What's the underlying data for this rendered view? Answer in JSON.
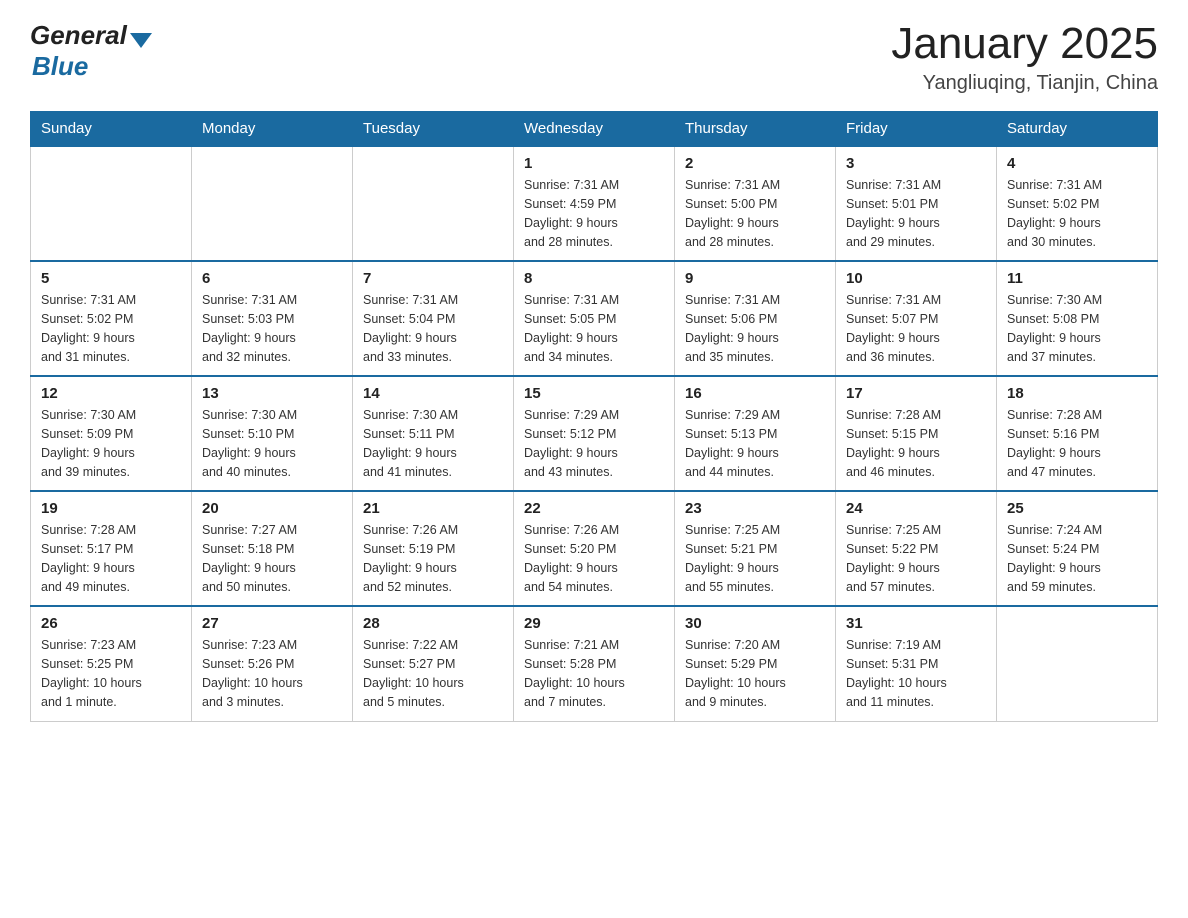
{
  "header": {
    "logo_general": "General",
    "logo_blue": "Blue",
    "month_year": "January 2025",
    "location": "Yangliuqing, Tianjin, China"
  },
  "weekdays": [
    "Sunday",
    "Monday",
    "Tuesday",
    "Wednesday",
    "Thursday",
    "Friday",
    "Saturday"
  ],
  "weeks": [
    [
      {
        "day": "",
        "info": ""
      },
      {
        "day": "",
        "info": ""
      },
      {
        "day": "",
        "info": ""
      },
      {
        "day": "1",
        "info": "Sunrise: 7:31 AM\nSunset: 4:59 PM\nDaylight: 9 hours\nand 28 minutes."
      },
      {
        "day": "2",
        "info": "Sunrise: 7:31 AM\nSunset: 5:00 PM\nDaylight: 9 hours\nand 28 minutes."
      },
      {
        "day": "3",
        "info": "Sunrise: 7:31 AM\nSunset: 5:01 PM\nDaylight: 9 hours\nand 29 minutes."
      },
      {
        "day": "4",
        "info": "Sunrise: 7:31 AM\nSunset: 5:02 PM\nDaylight: 9 hours\nand 30 minutes."
      }
    ],
    [
      {
        "day": "5",
        "info": "Sunrise: 7:31 AM\nSunset: 5:02 PM\nDaylight: 9 hours\nand 31 minutes."
      },
      {
        "day": "6",
        "info": "Sunrise: 7:31 AM\nSunset: 5:03 PM\nDaylight: 9 hours\nand 32 minutes."
      },
      {
        "day": "7",
        "info": "Sunrise: 7:31 AM\nSunset: 5:04 PM\nDaylight: 9 hours\nand 33 minutes."
      },
      {
        "day": "8",
        "info": "Sunrise: 7:31 AM\nSunset: 5:05 PM\nDaylight: 9 hours\nand 34 minutes."
      },
      {
        "day": "9",
        "info": "Sunrise: 7:31 AM\nSunset: 5:06 PM\nDaylight: 9 hours\nand 35 minutes."
      },
      {
        "day": "10",
        "info": "Sunrise: 7:31 AM\nSunset: 5:07 PM\nDaylight: 9 hours\nand 36 minutes."
      },
      {
        "day": "11",
        "info": "Sunrise: 7:30 AM\nSunset: 5:08 PM\nDaylight: 9 hours\nand 37 minutes."
      }
    ],
    [
      {
        "day": "12",
        "info": "Sunrise: 7:30 AM\nSunset: 5:09 PM\nDaylight: 9 hours\nand 39 minutes."
      },
      {
        "day": "13",
        "info": "Sunrise: 7:30 AM\nSunset: 5:10 PM\nDaylight: 9 hours\nand 40 minutes."
      },
      {
        "day": "14",
        "info": "Sunrise: 7:30 AM\nSunset: 5:11 PM\nDaylight: 9 hours\nand 41 minutes."
      },
      {
        "day": "15",
        "info": "Sunrise: 7:29 AM\nSunset: 5:12 PM\nDaylight: 9 hours\nand 43 minutes."
      },
      {
        "day": "16",
        "info": "Sunrise: 7:29 AM\nSunset: 5:13 PM\nDaylight: 9 hours\nand 44 minutes."
      },
      {
        "day": "17",
        "info": "Sunrise: 7:28 AM\nSunset: 5:15 PM\nDaylight: 9 hours\nand 46 minutes."
      },
      {
        "day": "18",
        "info": "Sunrise: 7:28 AM\nSunset: 5:16 PM\nDaylight: 9 hours\nand 47 minutes."
      }
    ],
    [
      {
        "day": "19",
        "info": "Sunrise: 7:28 AM\nSunset: 5:17 PM\nDaylight: 9 hours\nand 49 minutes."
      },
      {
        "day": "20",
        "info": "Sunrise: 7:27 AM\nSunset: 5:18 PM\nDaylight: 9 hours\nand 50 minutes."
      },
      {
        "day": "21",
        "info": "Sunrise: 7:26 AM\nSunset: 5:19 PM\nDaylight: 9 hours\nand 52 minutes."
      },
      {
        "day": "22",
        "info": "Sunrise: 7:26 AM\nSunset: 5:20 PM\nDaylight: 9 hours\nand 54 minutes."
      },
      {
        "day": "23",
        "info": "Sunrise: 7:25 AM\nSunset: 5:21 PM\nDaylight: 9 hours\nand 55 minutes."
      },
      {
        "day": "24",
        "info": "Sunrise: 7:25 AM\nSunset: 5:22 PM\nDaylight: 9 hours\nand 57 minutes."
      },
      {
        "day": "25",
        "info": "Sunrise: 7:24 AM\nSunset: 5:24 PM\nDaylight: 9 hours\nand 59 minutes."
      }
    ],
    [
      {
        "day": "26",
        "info": "Sunrise: 7:23 AM\nSunset: 5:25 PM\nDaylight: 10 hours\nand 1 minute."
      },
      {
        "day": "27",
        "info": "Sunrise: 7:23 AM\nSunset: 5:26 PM\nDaylight: 10 hours\nand 3 minutes."
      },
      {
        "day": "28",
        "info": "Sunrise: 7:22 AM\nSunset: 5:27 PM\nDaylight: 10 hours\nand 5 minutes."
      },
      {
        "day": "29",
        "info": "Sunrise: 7:21 AM\nSunset: 5:28 PM\nDaylight: 10 hours\nand 7 minutes."
      },
      {
        "day": "30",
        "info": "Sunrise: 7:20 AM\nSunset: 5:29 PM\nDaylight: 10 hours\nand 9 minutes."
      },
      {
        "day": "31",
        "info": "Sunrise: 7:19 AM\nSunset: 5:31 PM\nDaylight: 10 hours\nand 11 minutes."
      },
      {
        "day": "",
        "info": ""
      }
    ]
  ]
}
